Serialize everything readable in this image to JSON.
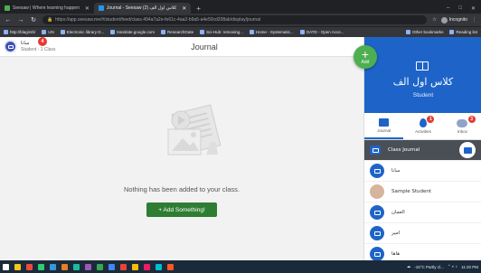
{
  "browser": {
    "tabs": [
      {
        "label": "Seesaw | Where learning happen",
        "active": false
      },
      {
        "label": "Journal - Seesaw كلاس اول الف (2)",
        "active": true
      }
    ],
    "new_tab": "+",
    "window_controls": [
      "‒",
      "□",
      "✕"
    ],
    "url": "https://app.seesaw.me/#/student/feed/class.494a7a2e-fe61c-4aa2-b9a5-a4e50cd208ab/display/journal",
    "incognito_label": "Incognito",
    "bookmarks": [
      "http://blagirsh/",
      "UN",
      "Electronic library D...",
      "translate.google.com",
      "ResearchGate",
      "Sci-Hub: removing...",
      "Home - Systematic...",
      "OATD - Open Acce..."
    ],
    "bookmarks_right": [
      "Other bookmarks",
      "Reading list"
    ]
  },
  "header": {
    "user_name": "سانا",
    "user_role": "Student - 1 Class",
    "notification_count": "4",
    "title": "Journal"
  },
  "fab": {
    "plus": "+",
    "label": "Add"
  },
  "empty_state": {
    "message": "Nothing has been added to your class.",
    "button_label": "+ Add Something!"
  },
  "class_panel": {
    "class_name": "كلاس اول الف",
    "role": "Student",
    "tabs": [
      {
        "label": "Journal",
        "badge": ""
      },
      {
        "label": "Activities",
        "badge": "1"
      },
      {
        "label": "Inbox",
        "badge": "3"
      }
    ],
    "items": [
      {
        "label": "Class Journal",
        "type": "class"
      },
      {
        "label": "سانا",
        "type": "student"
      },
      {
        "label": "Sample Student",
        "type": "face"
      },
      {
        "label": "العمان",
        "type": "student"
      },
      {
        "label": "امیر",
        "type": "student"
      },
      {
        "label": "هاها",
        "type": "student"
      }
    ]
  },
  "taskbar": {
    "weather": "-15°C Partly cl...",
    "time": "11:20 PM",
    "icon_colors": [
      "#ffffff",
      "#f5c518",
      "#e74c3c",
      "#2ecc71",
      "#3498db",
      "#e67e22",
      "#1abc9c",
      "#9b59b6",
      "#34a853",
      "#4285f4",
      "#ea4335",
      "#fbbc05",
      "#e91e63",
      "#00bcd4",
      "#ff5722"
    ]
  },
  "colors": {
    "brand": "#1e64c8",
    "add_green": "#4caf50",
    "button_green": "#2e7d32",
    "badge_red": "#e53935"
  }
}
